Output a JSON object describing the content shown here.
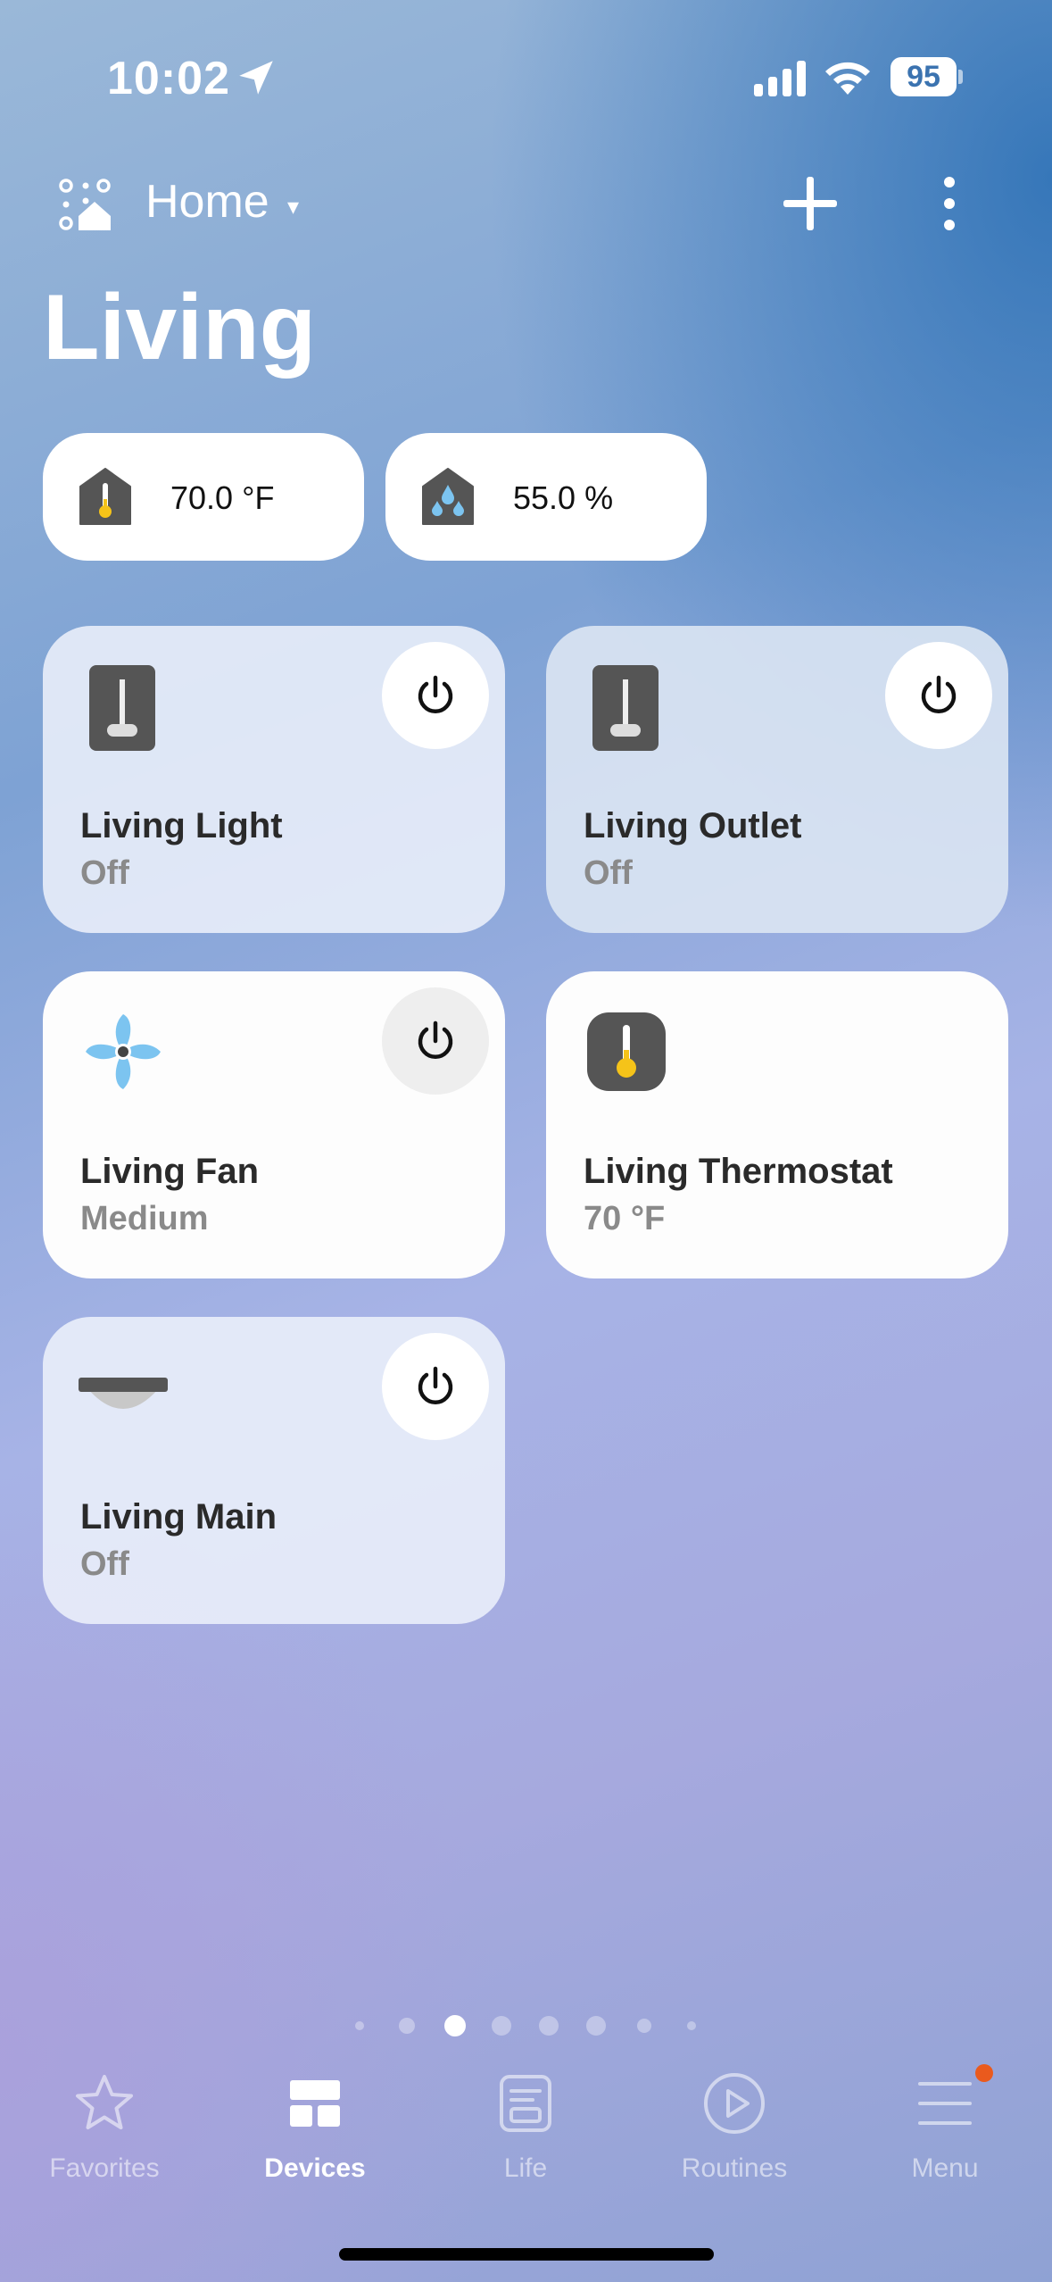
{
  "status_bar": {
    "time": "10:02",
    "battery": "95"
  },
  "header": {
    "home_label": "Home",
    "caret": "▾"
  },
  "room": {
    "title": "Living"
  },
  "sensors": [
    {
      "value": "70.0 °F",
      "icon": "temperature-sensor-icon"
    },
    {
      "value": "55.0 %",
      "icon": "humidity-sensor-icon"
    }
  ],
  "devices": [
    {
      "name": "Living Light",
      "state": "Off",
      "icon": "switch-icon",
      "power": "off"
    },
    {
      "name": "Living Outlet",
      "state": "Off",
      "icon": "switch-icon",
      "power": "off"
    },
    {
      "name": "Living Fan",
      "state": "Medium",
      "icon": "fan-icon",
      "power": "on"
    },
    {
      "name": "Living Thermostat",
      "state": "70 °F",
      "icon": "thermostat-icon"
    },
    {
      "name": "Living Main",
      "state": "Off",
      "icon": "ceiling-light-icon",
      "power": "off"
    }
  ],
  "page_indicator": {
    "count": 8,
    "active": 2
  },
  "tabs": [
    {
      "label": "Favorites",
      "icon": "star-icon"
    },
    {
      "label": "Devices",
      "icon": "devices-icon",
      "active": true
    },
    {
      "label": "Life",
      "icon": "life-icon"
    },
    {
      "label": "Routines",
      "icon": "play-icon"
    },
    {
      "label": "Menu",
      "icon": "menu-icon",
      "badge": true
    }
  ],
  "colors": {
    "accent_yellow": "#f5c319",
    "water_blue": "#7cc4f0",
    "device_dark": "#555555",
    "badge_orange": "#ea5a1d"
  }
}
